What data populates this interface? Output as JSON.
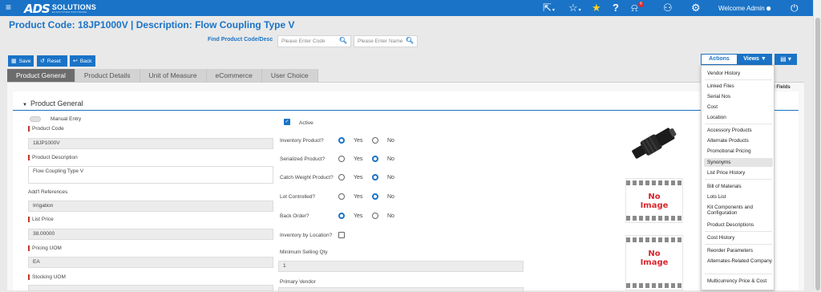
{
  "header": {
    "logo_main": "ADS",
    "logo_word": "SOLUTIONS",
    "logo_tag": "ECOSYSTEM SOFTWARE",
    "notification_count": "6",
    "welcome_text": "Welcome Admin",
    "colors": {
      "bar": "#1a73c7",
      "star": "#ffd21f",
      "badge": "#d9272e"
    }
  },
  "page": {
    "title": "Product Code:  18JP1000V | Description: Flow Coupling Type V",
    "find_label": "Find Product Code/Desc",
    "code_placeholder": "Please Enter Code",
    "name_placeholder": "Please Enter Name"
  },
  "toolbar": {
    "save": "Save",
    "reset": "Reset",
    "back": "Back"
  },
  "tabs": [
    "Product General",
    "Product Details",
    "Unit of Measure",
    "eCommerce",
    "User Choice"
  ],
  "section": {
    "title": "Product General"
  },
  "fields": {
    "manual_entry": "Manual Entry",
    "product_code_label": "Product Code",
    "product_code": "18JP1000V",
    "description_label": "Product Description",
    "description": "Flow Coupling Type V",
    "refs_label": "Add'l References",
    "refs": "Irrigation",
    "list_price_label": "List Price",
    "list_price": "38.00000",
    "pricing_uom_label": "Pricing UOM",
    "pricing_uom": "EA",
    "stocking_uom_label": "Stocking UOM",
    "active_label": "Active",
    "inventory_label": "Inventory Product?",
    "serialized_label": "Serialized Product?",
    "catch_weight_label": "Catch Weight Product?",
    "lot_label": "Lot Controlled?",
    "backorder_label": "Back Order?",
    "inv_location_label": "Inventory by Location?",
    "min_qty_label": "Minimum Selling Qty",
    "min_qty": "1",
    "vendor_label": "Primary Vendor",
    "yes": "Yes",
    "no": "No"
  },
  "radio_values": {
    "inventory": "yes",
    "serialized": "no",
    "catch_weight": "no",
    "lot_controlled": "no",
    "back_order": "yes"
  },
  "images": {
    "noimg_line1": "No",
    "noimg_line2": "Image"
  },
  "right_stub": "d Fields",
  "actions": {
    "actions_tab": "Actions",
    "views_tab": "Views ▼",
    "menu": [
      "Vendor History",
      "Linked Files",
      "Serial Nos",
      "Cost",
      "Location",
      "Accessory Products",
      "Alternate Products",
      "Promotional Pricing",
      "Synonyms",
      "List Price History",
      "Bill of Materials",
      "Lots List",
      "Kit Components and Configuration",
      "Product Descriptions",
      "Cost History",
      "Reorder Parameters",
      "Alternates-Related Company",
      "Multicurrency Price & Cost"
    ]
  }
}
